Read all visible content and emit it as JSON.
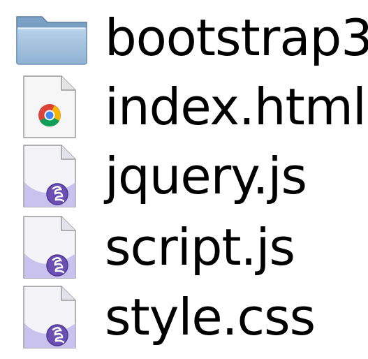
{
  "files": [
    {
      "name": "bootstrap3",
      "icon": "folder-icon"
    },
    {
      "name": "index.html",
      "icon": "chrome-html-document-icon"
    },
    {
      "name": "jquery.js",
      "icon": "emacs-document-icon"
    },
    {
      "name": "script.js",
      "icon": "emacs-document-icon"
    },
    {
      "name": "style.css",
      "icon": "emacs-document-icon"
    }
  ]
}
